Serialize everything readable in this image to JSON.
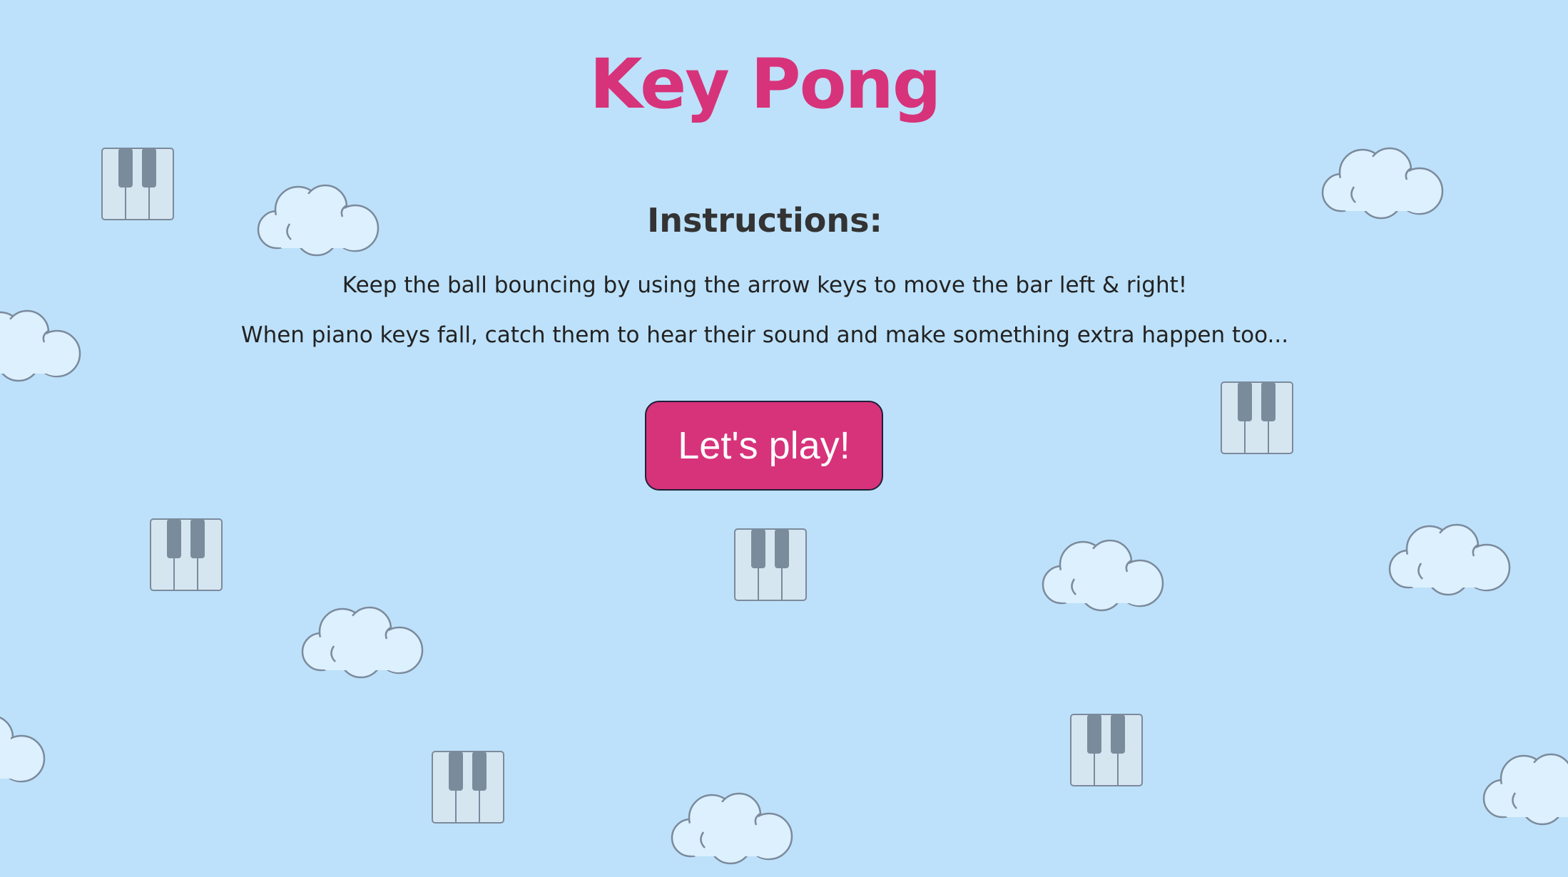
{
  "game": {
    "title": "Key Pong",
    "instructions_heading": "Instructions:",
    "instructions": [
      "Keep the ball bouncing by using the arrow keys to move the bar left & right!",
      "When piano keys fall, catch them to hear their sound and make something extra happen too..."
    ],
    "play_button_label": "Let's play!"
  },
  "colors": {
    "background": "#bde1fa",
    "accent": "#d7337a",
    "cloud_fill": "#dcf0fd",
    "cloud_stroke": "#7b8a9c",
    "piano_white": "#d6e6f1",
    "piano_black": "#7a8c9c"
  },
  "icons": {
    "decoration_a": "piano-keys-icon",
    "decoration_b": "cloud-icon"
  }
}
